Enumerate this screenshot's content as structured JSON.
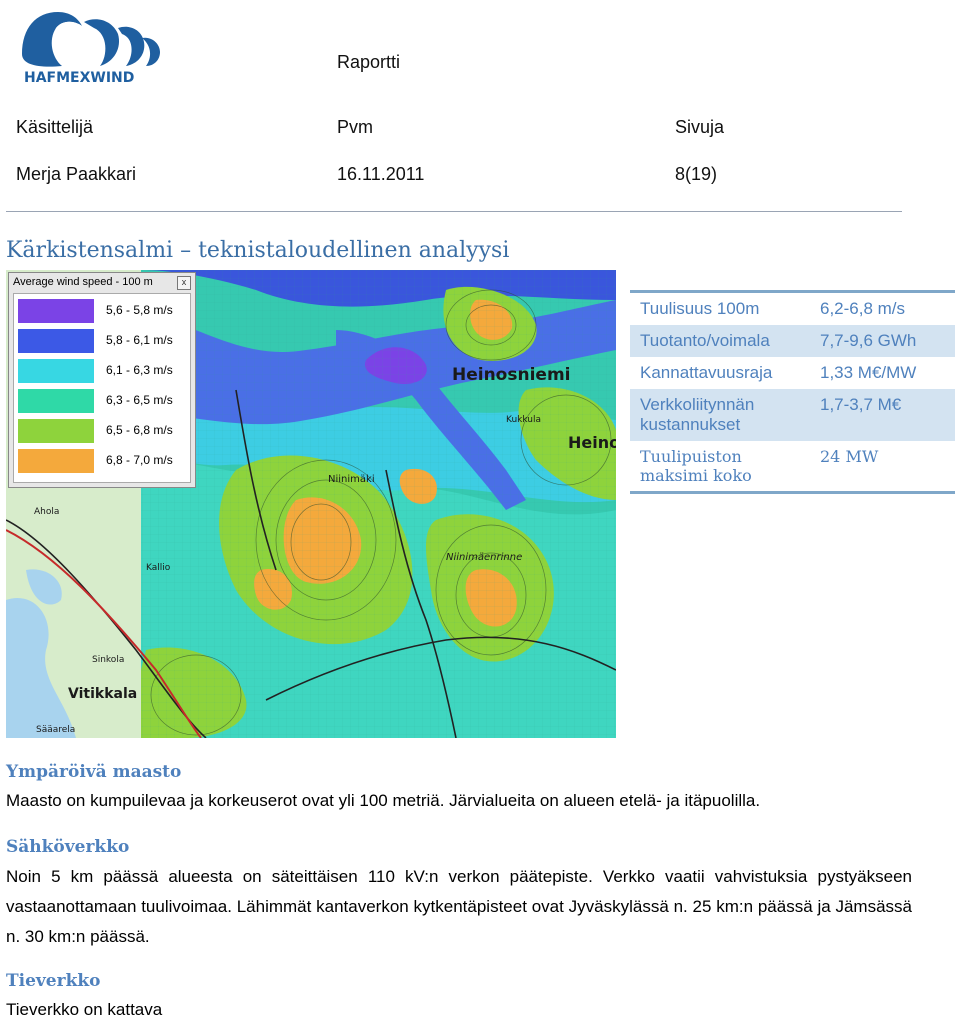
{
  "logo": {
    "text": "HAFMEXWIND",
    "colors": {
      "blue": "#1f5fa0",
      "red": "#e03025"
    }
  },
  "header": {
    "doc_type": "Raportti",
    "col1_label": "Käsittelijä",
    "col2_label": "Pvm",
    "col3_label": "Sivuja",
    "col1_value": "Merja Paakkari",
    "col2_value": "16.11.2011",
    "col3_value": "8(19)"
  },
  "title": "Kärkistensalmi – teknistaloudellinen analyysi",
  "map": {
    "legend_title": "Average wind speed - 100 m",
    "legend_close": "x",
    "legend": [
      {
        "label": "5,6 - 5,8 m/s",
        "color": "#7b43e6"
      },
      {
        "label": "5,8 - 6,1 m/s",
        "color": "#3c59e6"
      },
      {
        "label": "6,1 - 6,3 m/s",
        "color": "#37d7e3"
      },
      {
        "label": "6,3 - 6,5 m/s",
        "color": "#2fd9a7"
      },
      {
        "label": "6,5 - 6,8 m/s",
        "color": "#8ed33c"
      },
      {
        "label": "6,8 - 7,0 m/s",
        "color": "#f4a93c"
      }
    ],
    "place_labels": {
      "heinosniemi": "Heinosniemi",
      "heinos": "Heinos",
      "vitikkala": "Vitikkala",
      "kukkula": "Kukkula",
      "niinimaki": "Niinimäki",
      "niinimaenrinne": "Niinimäenrinne",
      "sinkola": "Sinkola",
      "ahola": "Ahola",
      "saaarela": "Sääarela",
      "kallio": "Kallio"
    }
  },
  "summary": [
    {
      "key": "Tuulisuus 100m",
      "value": "6,2-6,8 m/s"
    },
    {
      "key": "Tuotanto/voimala",
      "value": "7,7-9,6 GWh"
    },
    {
      "key": "Kannattavuusraja",
      "value": "1,33 M€/MW"
    },
    {
      "key": "Verkkoliitynnän kustannukset",
      "value": "1,7-3,7 M€"
    },
    {
      "key": "Tuulipuiston maksimi koko",
      "value": "24 MW"
    }
  ],
  "sections": {
    "terrain": {
      "heading": "Ympäröivä maasto",
      "text": "Maasto on kumpuilevaa ja korkeuserot ovat yli 100 metriä. Järvialueita on alueen etelä- ja itäpuolilla."
    },
    "grid": {
      "heading": "Sähköverkko",
      "text": "Noin 5 km päässä alueesta on säteittäisen 110 kV:n verkon päätepiste. Verkko vaatii vahvistuksia pystyäkseen vastaanottamaan tuulivoimaa. Lähimmät kantaverkon kytkentäpisteet ovat Jyväskylässä n. 25 km:n päässä ja Jämsässä n. 30 km:n päässä."
    },
    "roads": {
      "heading": "Tieverkko",
      "text": "Tieverkko on kattava"
    }
  }
}
